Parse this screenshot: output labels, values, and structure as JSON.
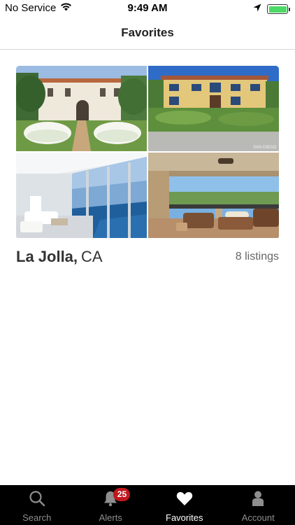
{
  "status_bar": {
    "carrier": "No Service",
    "time": "9:49 AM",
    "battery_level": 1.0,
    "icons": [
      "wifi-icon",
      "location-arrow-icon",
      "battery-icon"
    ]
  },
  "nav": {
    "title": "Favorites"
  },
  "favorites": [
    {
      "city": "La Jolla,",
      "state": "CA",
      "listings": "8 listings",
      "photo_watermark": "SAN DIEGO",
      "photos": [
        "mediterranean-villa-photo",
        "yellow-house-photo",
        "ocean-view-living-room-photo",
        "covered-patio-photo"
      ]
    }
  ],
  "tab_bar": {
    "tabs": [
      {
        "label": "Search",
        "icon": "search-icon",
        "active": false
      },
      {
        "label": "Alerts",
        "icon": "bell-icon",
        "active": false,
        "badge": "25"
      },
      {
        "label": "Favorites",
        "icon": "heart-icon",
        "active": true
      },
      {
        "label": "Account",
        "icon": "person-icon",
        "active": false
      }
    ]
  },
  "colors": {
    "tab_bar_bg": "#000000",
    "tab_active": "#ffffff",
    "tab_inactive": "#8e8e8e",
    "badge": "#c0171d",
    "battery_fill": "#4cd964"
  }
}
